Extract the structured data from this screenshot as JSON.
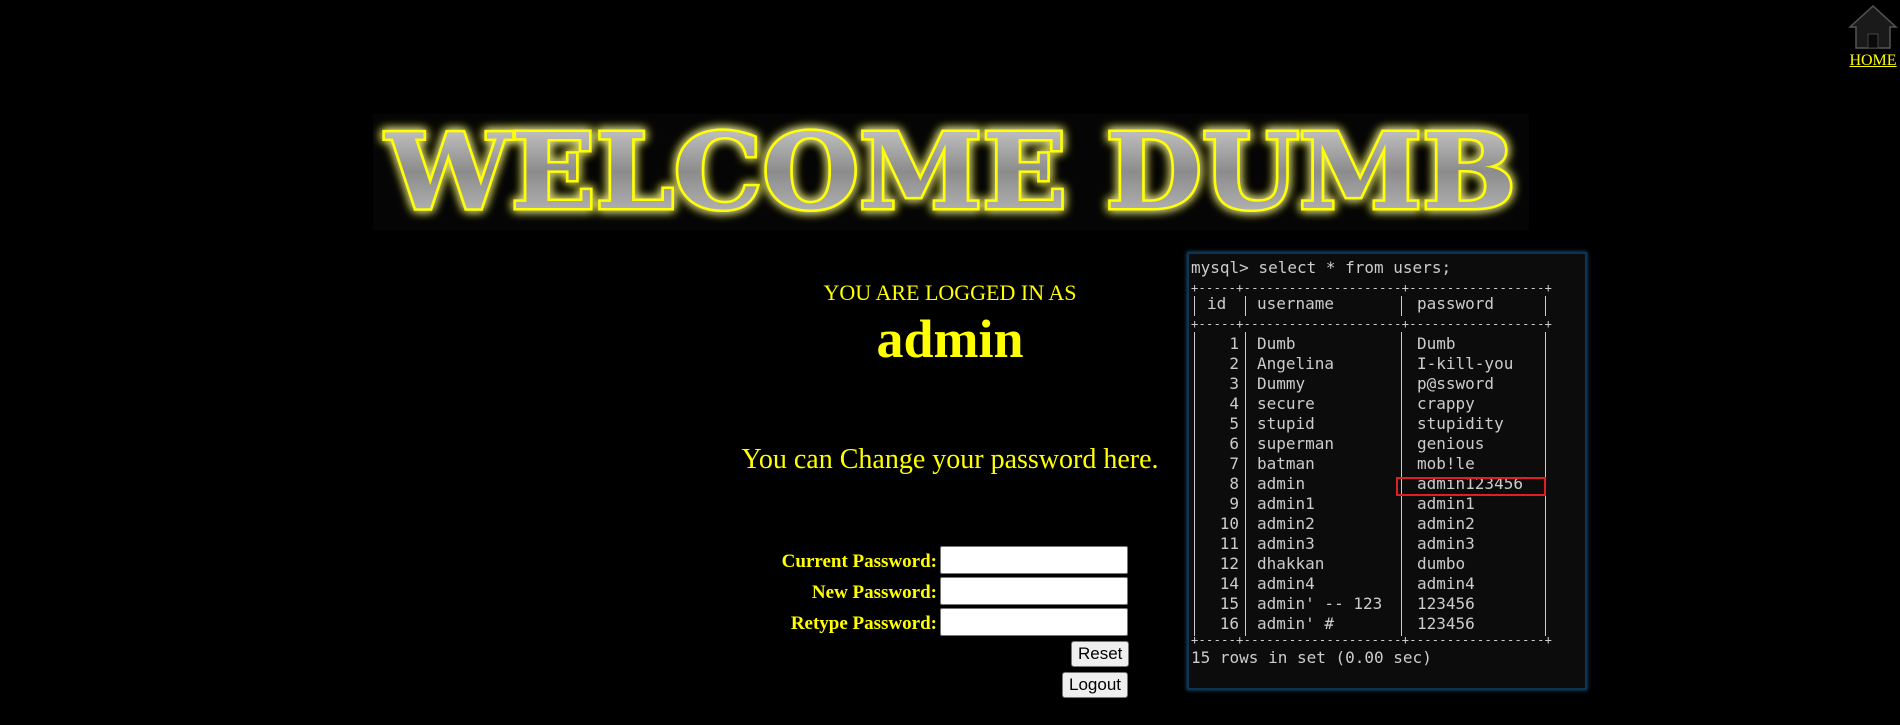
{
  "nav": {
    "home_label": "HOME"
  },
  "banner": {
    "text": "WELCOME DUMB"
  },
  "login": {
    "logged_label": "YOU ARE LOGGED IN AS",
    "username": "admin"
  },
  "change": {
    "text": "You can Change your password here."
  },
  "form": {
    "current_label": "Current Password:",
    "current_value": "",
    "new_label": "New Password:",
    "new_value": "",
    "retype_label": "Retype Password:",
    "retype_value": "",
    "reset_label": "Reset",
    "logout_label": "Logout"
  },
  "terminal": {
    "command": "mysql> select * from users;",
    "headers": [
      "id",
      "username",
      "password"
    ],
    "rows": [
      [
        "1",
        "Dumb",
        "Dumb"
      ],
      [
        "2",
        "Angelina",
        "I-kill-you"
      ],
      [
        "3",
        "Dummy",
        "p@ssword"
      ],
      [
        "4",
        "secure",
        "crappy"
      ],
      [
        "5",
        "stupid",
        "stupidity"
      ],
      [
        "6",
        "superman",
        "genious"
      ],
      [
        "7",
        "batman",
        "mob!le"
      ],
      [
        "8",
        "admin",
        "admin123456"
      ],
      [
        "9",
        "admin1",
        "admin1"
      ],
      [
        "10",
        "admin2",
        "admin2"
      ],
      [
        "11",
        "admin3",
        "admin3"
      ],
      [
        "12",
        "dhakkan",
        "dumbo"
      ],
      [
        "14",
        "admin4",
        "admin4"
      ],
      [
        "15",
        "admin' -- 123",
        "123456"
      ],
      [
        "16",
        "admin' #",
        "123456"
      ]
    ],
    "footer": "15 rows in set (0.00 sec)",
    "highlight_row_index": 7,
    "highlight_color": "#e02020"
  },
  "colors": {
    "accent": "#ffff00",
    "background": "#000000",
    "terminal_text": "#cccccc"
  }
}
